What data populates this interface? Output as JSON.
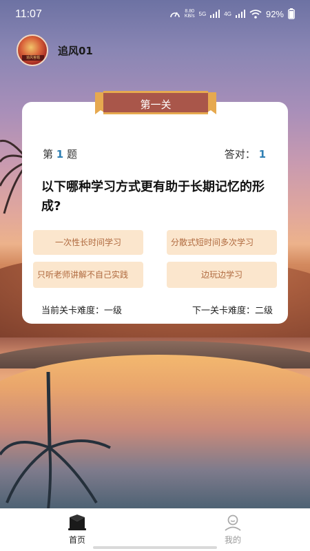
{
  "status": {
    "time": "11:07",
    "speed_value": "8.80",
    "speed_unit": "KB/s",
    "network_5g": "5G",
    "network_4g": "4G",
    "battery": "92%"
  },
  "user": {
    "name": "追风01",
    "avatar_caption": "追风答题"
  },
  "level": {
    "title": "第一关"
  },
  "quiz": {
    "question_prefix": "第",
    "question_index": "1",
    "question_suffix": "题",
    "correct_label": "答对：",
    "correct_count": "1",
    "question_text": "以下哪种学习方式更有助于长期记忆的形成?",
    "options": [
      "一次性长时间学习",
      "分散式短时间多次学习",
      "只听老师讲解不自己实践",
      "边玩边学习"
    ],
    "current_difficulty": "当前关卡难度：一级",
    "next_difficulty": "下一关卡难度：二级"
  },
  "tabs": {
    "home": "首页",
    "mine": "我的"
  },
  "colors": {
    "accent_blue": "#2f7fb3",
    "option_bg": "#fbe6cd",
    "option_text": "#b06a3f",
    "banner": "#a9564a"
  }
}
